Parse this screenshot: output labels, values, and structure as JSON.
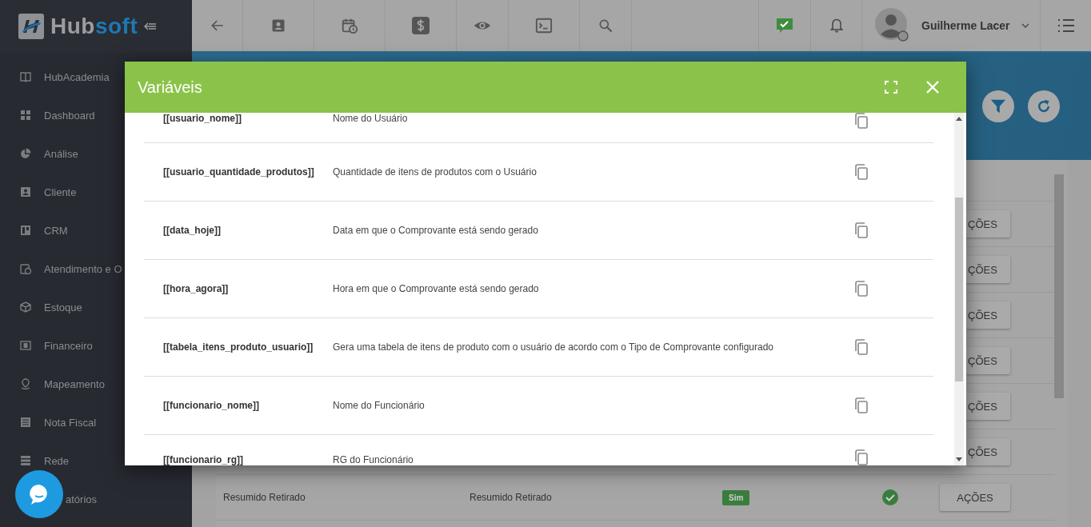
{
  "logo": {
    "text": "Hub",
    "accent": "soft"
  },
  "topbar": {
    "user_name": "Guilherme Lacer"
  },
  "sidebar": {
    "items": [
      {
        "label": "HubAcademia"
      },
      {
        "label": "Dashboard"
      },
      {
        "label": "Análise"
      },
      {
        "label": "Cliente"
      },
      {
        "label": "CRM"
      },
      {
        "label": "Atendimento e O"
      },
      {
        "label": "Estoque"
      },
      {
        "label": "Financeiro"
      },
      {
        "label": "Mapeamento"
      },
      {
        "label": "Nota Fiscal"
      },
      {
        "label": "Rede"
      },
      {
        "label": "atórios"
      }
    ]
  },
  "table": {
    "rows": [
      {
        "kind": "covered",
        "action": "ÇÕES"
      },
      {
        "kind": "covered",
        "action": "ÇÕES"
      },
      {
        "kind": "covered",
        "action": "ÇÕES"
      },
      {
        "kind": "covered",
        "action": "ÇÕES"
      },
      {
        "kind": "covered",
        "action": "ÇÕES"
      },
      {
        "kind": "covered",
        "action": "ÇÕES"
      },
      {
        "kind": "full",
        "cells": [
          "Resumido Retirado",
          "Resumido Retirado"
        ],
        "badge": "Sim",
        "checked": true,
        "action": "AÇÕES"
      }
    ]
  },
  "modal": {
    "title": "Variáveis",
    "rows": [
      {
        "kind": "top",
        "variable": "[[usuario_nome]]",
        "description": "Nome do Usuário"
      },
      {
        "kind": "full",
        "variable": "[[usuario_quantidade_produtos]]",
        "description": "Quantidade de itens de produtos com o Usuário"
      },
      {
        "kind": "full",
        "variable": "[[data_hoje]]",
        "description": "Data em que o Comprovante está sendo gerado"
      },
      {
        "kind": "full",
        "variable": "[[hora_agora]]",
        "description": "Hora em que o Comprovante está sendo gerado"
      },
      {
        "kind": "full",
        "variable": "[[tabela_itens_produto_usuario]]",
        "description": "Gera uma tabela de itens de produto com o usuário de acordo com o Tipo de Comprovante configurado"
      },
      {
        "kind": "full",
        "variable": "[[funcionario_nome]]",
        "description": "Nome do Funcionário"
      },
      {
        "kind": "bottom",
        "variable": "[[funcionario_rg]]",
        "description": "RG do Funcionário"
      }
    ]
  }
}
